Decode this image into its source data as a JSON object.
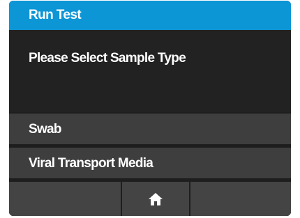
{
  "header": {
    "title": "Run Test"
  },
  "prompt": {
    "text": "Please Select Sample Type"
  },
  "options": [
    {
      "label": "Swab"
    },
    {
      "label": "Viral Transport Media"
    }
  ],
  "nav": {
    "home_icon": "home-icon"
  },
  "colors": {
    "accent": "#0d96d6",
    "background": "#222222",
    "option_bg": "#3e3e3e",
    "nav_bg": "#444444",
    "text": "#ffffff"
  }
}
